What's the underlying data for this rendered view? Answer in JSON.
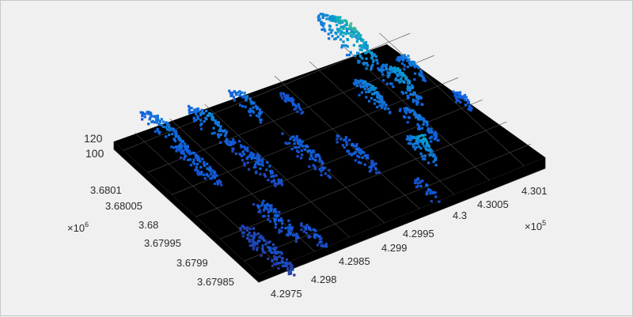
{
  "chart_data": {
    "type": "scatter3d",
    "title": "",
    "xlabel": "",
    "ylabel": "",
    "zlabel": "",
    "colormap": "parula",
    "background": "#000000",
    "grid": true,
    "x_multiplier": "×10",
    "x_exponent": "5",
    "y_multiplier": "×10",
    "y_exponent": "6",
    "x_ticks": [
      "4.2975",
      "4.298",
      "4.2985",
      "4.299",
      "4.2995",
      "4.3",
      "4.3005",
      "4.301"
    ],
    "y_ticks": [
      "3.67985",
      "3.6799",
      "3.67995",
      "3.68",
      "3.68005",
      "3.6801"
    ],
    "z_ticks": [
      "100",
      "120"
    ],
    "xlim": [
      4.2972,
      4.3013
    ],
    "ylim": [
      3.67982,
      3.68012
    ],
    "zlim": [
      90,
      128
    ],
    "clusters": [
      {
        "x": 4.2978,
        "y": 3.6801,
        "z": 108,
        "r": 0.00011,
        "n": 110
      },
      {
        "x": 4.2983,
        "y": 3.68008,
        "z": 110,
        "r": 0.0001,
        "n": 90
      },
      {
        "x": 4.2989,
        "y": 3.68009,
        "z": 108,
        "r": 8e-05,
        "n": 60
      },
      {
        "x": 4.2994,
        "y": 3.68007,
        "z": 102,
        "r": 5e-05,
        "n": 40
      },
      {
        "x": 4.2978,
        "y": 3.68003,
        "z": 104,
        "r": 0.0001,
        "n": 90
      },
      {
        "x": 4.2984,
        "y": 3.68,
        "z": 102,
        "r": 0.00012,
        "n": 100
      },
      {
        "x": 4.299,
        "y": 3.67998,
        "z": 103,
        "r": 0.00011,
        "n": 80
      },
      {
        "x": 4.2995,
        "y": 3.67995,
        "z": 103,
        "r": 0.0001,
        "n": 70
      },
      {
        "x": 4.298,
        "y": 3.6799,
        "z": 102,
        "r": 0.0001,
        "n": 90
      },
      {
        "x": 4.2976,
        "y": 3.67986,
        "z": 99,
        "r": 0.00012,
        "n": 130
      },
      {
        "x": 4.2982,
        "y": 3.67985,
        "z": 101,
        "r": 6e-05,
        "n": 40
      },
      {
        "x": 4.3005,
        "y": 3.68011,
        "z": 122,
        "r": 0.00014,
        "n": 220
      },
      {
        "x": 4.3002,
        "y": 3.68002,
        "z": 112,
        "r": 8e-05,
        "n": 90
      },
      {
        "x": 4.3006,
        "y": 3.68002,
        "z": 114,
        "r": 0.0001,
        "n": 120
      },
      {
        "x": 4.3009,
        "y": 3.68004,
        "z": 110,
        "r": 7e-05,
        "n": 60
      },
      {
        "x": 4.3004,
        "y": 3.67995,
        "z": 108,
        "r": 9e-05,
        "n": 80
      },
      {
        "x": 4.3001,
        "y": 3.6799,
        "z": 115,
        "r": 7e-05,
        "n": 90
      },
      {
        "x": 4.3011,
        "y": 3.67996,
        "z": 105,
        "r": 5e-05,
        "n": 40
      },
      {
        "x": 4.2998,
        "y": 3.67985,
        "z": 102,
        "r": 6e-05,
        "n": 30
      }
    ]
  }
}
